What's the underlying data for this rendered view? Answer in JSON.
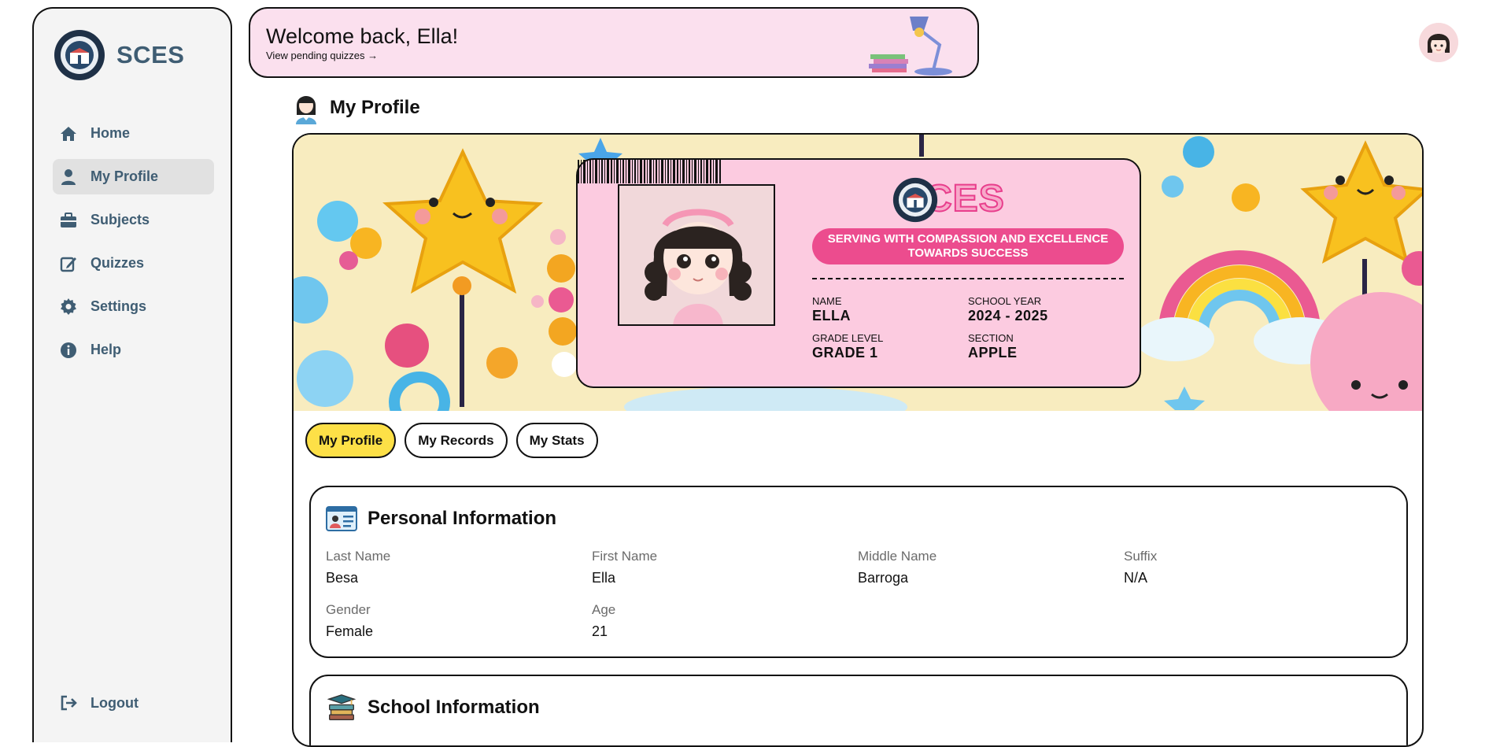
{
  "brand": {
    "name": "SCES"
  },
  "nav": {
    "items": [
      {
        "label": "Home",
        "icon": "home-icon"
      },
      {
        "label": "My Profile",
        "icon": "user-icon"
      },
      {
        "label": "Subjects",
        "icon": "briefcase-icon"
      },
      {
        "label": "Quizzes",
        "icon": "edit-icon"
      },
      {
        "label": "Settings",
        "icon": "gear-icon"
      },
      {
        "label": "Help",
        "icon": "info-icon"
      }
    ],
    "active": "My Profile",
    "logout": "Logout"
  },
  "welcome": {
    "title": "Welcome back, Ella!",
    "link": "View pending quizzes →"
  },
  "page": {
    "title": "My Profile"
  },
  "id_card": {
    "brand": "SCES",
    "motto": "SERVING WITH COMPASSION AND EXCELLENCE TOWARDS SUCCESS",
    "name_label": "NAME",
    "name": "ELLA",
    "school_year_label": "SCHOOL YEAR",
    "school_year": "2024 - 2025",
    "grade_label": "GRADE LEVEL",
    "grade": "GRADE 1",
    "section_label": "SECTION",
    "section": "APPLE"
  },
  "tabs": [
    {
      "label": "My Profile",
      "active": true
    },
    {
      "label": "My Records",
      "active": false
    },
    {
      "label": "My Stats",
      "active": false
    }
  ],
  "personal": {
    "title": "Personal Information",
    "fields": [
      {
        "label": "Last Name",
        "value": "Besa"
      },
      {
        "label": "First Name",
        "value": "Ella"
      },
      {
        "label": "Middle Name",
        "value": "Barroga"
      },
      {
        "label": "Suffix",
        "value": "N/A"
      },
      {
        "label": "Gender",
        "value": "Female"
      },
      {
        "label": "Age",
        "value": "21"
      }
    ]
  },
  "school": {
    "title": "School Information"
  },
  "colors": {
    "accent_nav": "#3f5d73",
    "welcome_bg": "#fbe0ee",
    "idcard_bg": "#fccbe0",
    "motto_bg": "#ec4c8e",
    "tab_active": "#fde047"
  }
}
